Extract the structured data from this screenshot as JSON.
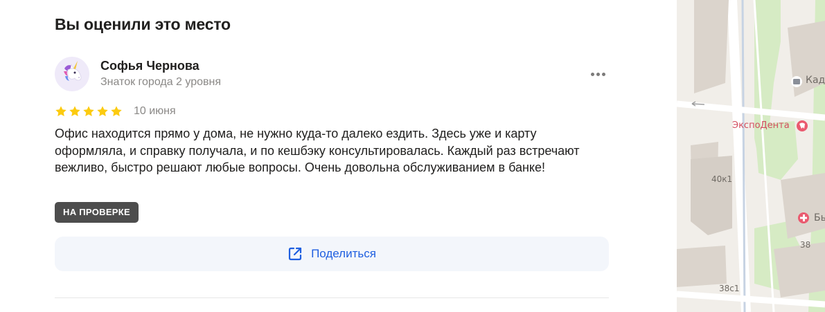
{
  "section": {
    "title": "Вы оценили это место"
  },
  "review": {
    "author": {
      "name": "Софья Чернова",
      "level": "Знаток города 2 уровня",
      "avatar_icon": "unicorn-icon"
    },
    "rating": 5,
    "max_rating": 5,
    "star_color": "#fccb10",
    "date": "10 июня",
    "text": "Офис находится прямо у дома, не нужно куда-то далеко ездить. Здесь уже и карту оформляла, и справку получала, и по кешбэку консультировалась. Каждый раз встречают вежливо, быстро решают любые вопросы. Очень довольна обслуживанием в банке!",
    "status_badge": "НА ПРОВЕРКЕ",
    "more_icon": "more-dots-icon"
  },
  "actions": {
    "share_label": "Поделиться",
    "share_icon": "share-external-icon",
    "accent_color": "#1f5fe0"
  },
  "map": {
    "labels": {
      "place_a": "ЭкспоДента",
      "place_b_partial": "Кад",
      "place_c_partial": "Бы",
      "house_1": "40к1",
      "house_2": "38",
      "house_3": "38с1"
    },
    "poi_icons": [
      "briefcase-icon",
      "tooth-icon",
      "medical-cross-icon"
    ]
  }
}
